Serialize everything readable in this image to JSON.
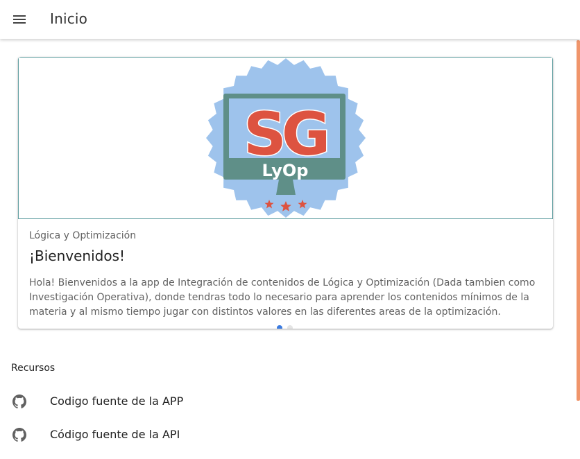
{
  "appbar": {
    "title": "Inicio",
    "menu_icon": "menu-icon"
  },
  "card": {
    "logo": {
      "top_text": "SG",
      "bottom_text": "LyOp"
    },
    "overline": "Lógica y Optimización",
    "title": "¡Bienvenidos!",
    "text": "Hola! Bienvenidos a la app de Integración de contenidos de Lógica y Optimización (Dada tambien como Investigación Operativa), donde tendras todo lo necesario para aprender los contenidos mínimos de la materia y al mismo tiempo jugar con distintos valores en las diferentes areas de la optimización.",
    "carousel": {
      "active_index": 0,
      "count": 2
    }
  },
  "resources": {
    "heading": "Recursos",
    "items": [
      {
        "label": "Codigo fuente de la APP",
        "icon": "github-icon"
      },
      {
        "label": "Código fuente de la API",
        "icon": "github-icon"
      }
    ]
  },
  "colors": {
    "accent_blue": "#3b7be0",
    "logo_badge": "#9ec3ec",
    "logo_red": "#dd5340",
    "logo_monitor": "#5f8f88",
    "scrollbar": "#f0956b"
  }
}
